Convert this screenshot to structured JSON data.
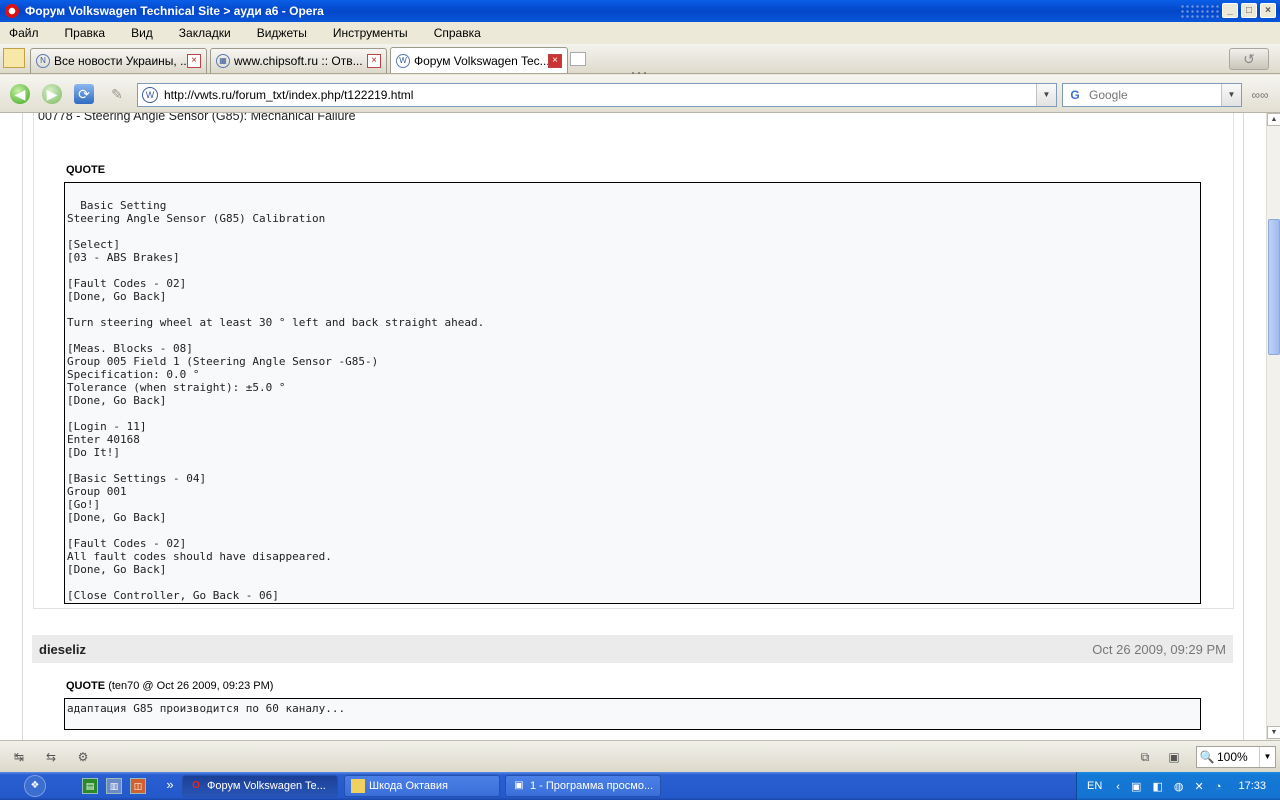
{
  "window": {
    "title": "Форум Volkswagen Technical Site > ауди а6 - Opera",
    "buttons": {
      "minimize": "_",
      "maximize": "□",
      "close": "×"
    }
  },
  "menu": [
    "Файл",
    "Правка",
    "Вид",
    "Закладки",
    "Виджеты",
    "Инструменты",
    "Справка"
  ],
  "tabs": [
    {
      "label": "Все новости Украины, ...",
      "favicon": "N",
      "close": "×",
      "active": false
    },
    {
      "label": "www.chipsoft.ru :: Отв...",
      "favicon": "▦",
      "close": "×",
      "active": false
    },
    {
      "label": "Форум Volkswagen Tec...",
      "favicon": "W",
      "close": "×",
      "active": true
    }
  ],
  "icons": {
    "back": "◀",
    "forward": "▶",
    "reload": "⟳",
    "wand": "✎",
    "dropdown": "▼",
    "site_favicon": "W",
    "google_g": "G",
    "glasses": "∞∞",
    "trash": "↺",
    "zoom": "🔍",
    "statusbar": [
      "↹",
      "⇆",
      "⚙",
      "⧉",
      "▣"
    ]
  },
  "address": {
    "url": "http://vwts.ru/forum_txt/index.php/t122219.html"
  },
  "search": {
    "placeholder": "Google"
  },
  "content": {
    "pre_line": "00778 - Steering Angle Sensor (G85): Mechanical Failure",
    "quote1": {
      "label": "QUOTE",
      "lines": [
        "",
        "  Basic Setting",
        "Steering Angle Sensor (G85) Calibration",
        "",
        "[Select]",
        "[03 - ABS Brakes]",
        "",
        "[Fault Codes - 02]",
        "[Done, Go Back]",
        "",
        "Turn steering wheel at least 30 ° left and back straight ahead.",
        "",
        "[Meas. Blocks - 08]",
        "Group 005 Field 1 (Steering Angle Sensor -G85-)",
        "Specification: 0.0 °",
        "Tolerance (when straight): ±5.0 °",
        "[Done, Go Back]",
        "",
        "[Login - 11]",
        "Enter 40168",
        "[Do It!]",
        "",
        "[Basic Settings - 04]",
        "Group 001",
        "[Go!]",
        "[Done, Go Back]",
        "",
        "[Fault Codes - 02]",
        "All fault codes should have disappeared.",
        "[Done, Go Back]",
        "",
        "[Close Controller, Go Back - 06]"
      ]
    },
    "post2": {
      "author": "dieseliz",
      "date": "Oct 26 2009, 09:29 PM",
      "quote_label": "QUOTE",
      "quote_meta": "(ten70 @ Oct 26 2009, 09:23 PM)",
      "quote_text": "адаптация G85 производится по 60 каналу..."
    }
  },
  "zoom": {
    "value": "100%"
  },
  "taskbar": {
    "start_icon": "❖",
    "quicklaunch": [
      "▤",
      "▥",
      "◫"
    ],
    "overflow": "»",
    "buttons": [
      {
        "label": "Форум Volkswagen Te...",
        "icon": "O",
        "active": true
      },
      {
        "label": "Шкода Октавия",
        "icon": "▭",
        "active": false
      },
      {
        "label": "1 - Программа просмо...",
        "icon": "▣",
        "active": false
      }
    ],
    "lang": "EN",
    "tray_icons": "‹ ▣ ◧ ◍ ✕ ◔",
    "clock": "17:33"
  }
}
